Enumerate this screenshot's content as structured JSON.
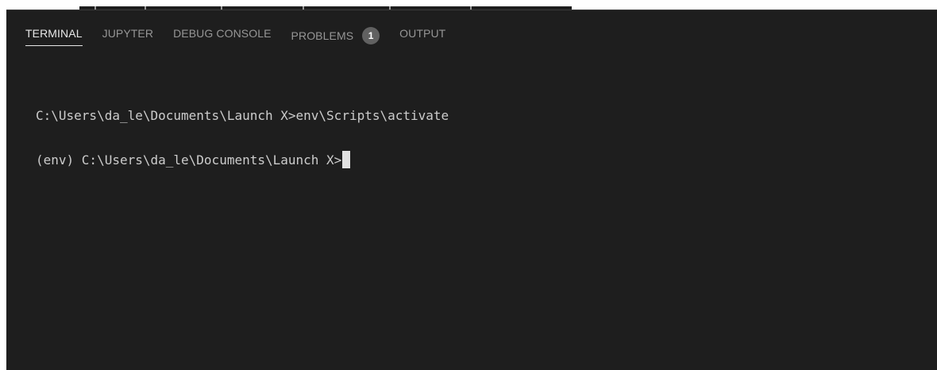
{
  "panel": {
    "tabs": [
      {
        "label": "TERMINAL",
        "active": true
      },
      {
        "label": "JUPYTER",
        "active": false
      },
      {
        "label": "DEBUG CONSOLE",
        "active": false
      },
      {
        "label": "PROBLEMS",
        "active": false,
        "badge": "1"
      },
      {
        "label": "OUTPUT",
        "active": false
      }
    ]
  },
  "terminal": {
    "lines": [
      "C:\\Users\\da_le\\Documents\\Launch X>env\\Scripts\\activate",
      "(env) C:\\Users\\da_le\\Documents\\Launch X>"
    ]
  },
  "colors": {
    "background": "#1e1e1e",
    "tab_active": "#e7e7e7",
    "tab_inactive": "#969696",
    "badge_bg": "#616161",
    "terminal_text": "#cccccc"
  }
}
